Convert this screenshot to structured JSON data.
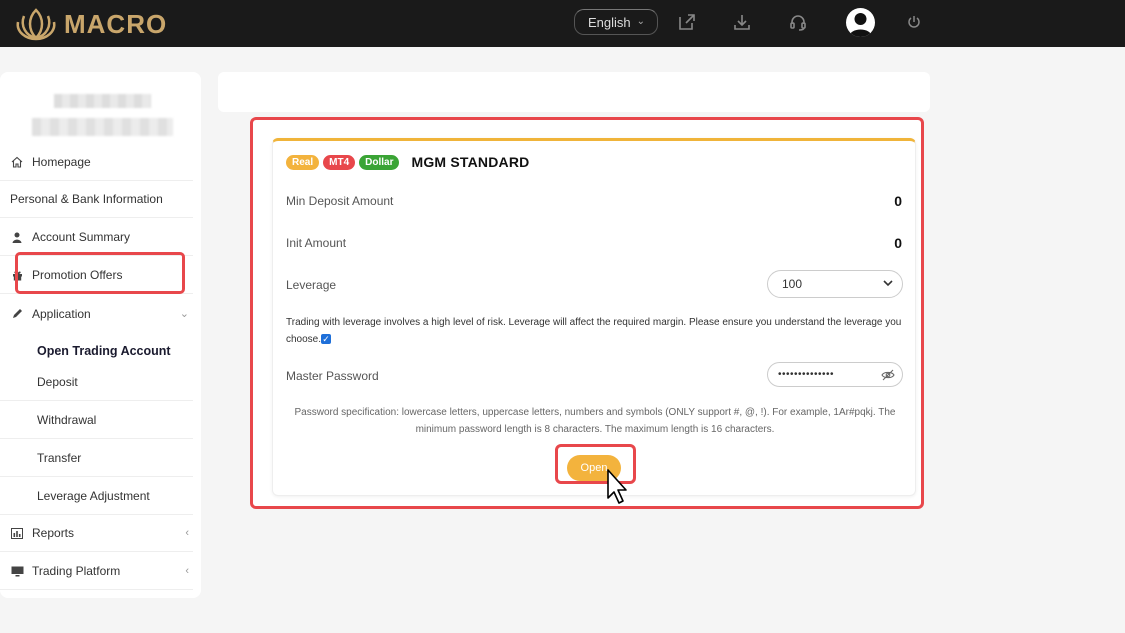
{
  "header": {
    "brand": "MACRO",
    "language": "English"
  },
  "sidebar": {
    "items": [
      {
        "label": "Homepage",
        "icon": "home-icon"
      },
      {
        "label": "Personal & Bank Information"
      },
      {
        "label": "Account Summary",
        "icon": "user-icon"
      },
      {
        "label": "Promotion Offers",
        "icon": "gift-icon"
      },
      {
        "label": "Application",
        "icon": "pen-icon"
      }
    ],
    "application_sub": [
      {
        "label": "Open Trading Account",
        "active": true
      },
      {
        "label": "Deposit"
      },
      {
        "label": "Withdrawal"
      },
      {
        "label": "Transfer"
      },
      {
        "label": "Leverage Adjustment"
      }
    ],
    "bottom_items": [
      {
        "label": "Reports",
        "icon": "chart-icon"
      },
      {
        "label": "Trading Platform",
        "icon": "monitor-icon"
      }
    ]
  },
  "card": {
    "badges": {
      "real": "Real",
      "mt4": "MT4",
      "dollar": "Dollar"
    },
    "account_name": "MGM STANDARD",
    "min_deposit_label": "Min Deposit Amount",
    "min_deposit_value": "0",
    "init_amount_label": "Init Amount",
    "init_amount_value": "0",
    "leverage_label": "Leverage",
    "leverage_value": "100",
    "risk_text": "Trading with leverage involves a high level of risk. Leverage will affect the required margin. Please ensure you understand the leverage you choose.",
    "master_password_label": "Master Password",
    "master_password_value": "••••••••••••••",
    "spec_text": "Password specification: lowercase letters, uppercase letters, numbers and symbols (ONLY support #, @, !). For example, 1Ar#pqkj. The minimum password length is 8 characters. The maximum length is 16 characters.",
    "open_label": "Open"
  },
  "colors": {
    "accent": "#f3b33d",
    "highlight": "#e8474b",
    "mt4": "#e8474b",
    "dollar": "#3aa435",
    "brand": "#c9a66b"
  }
}
